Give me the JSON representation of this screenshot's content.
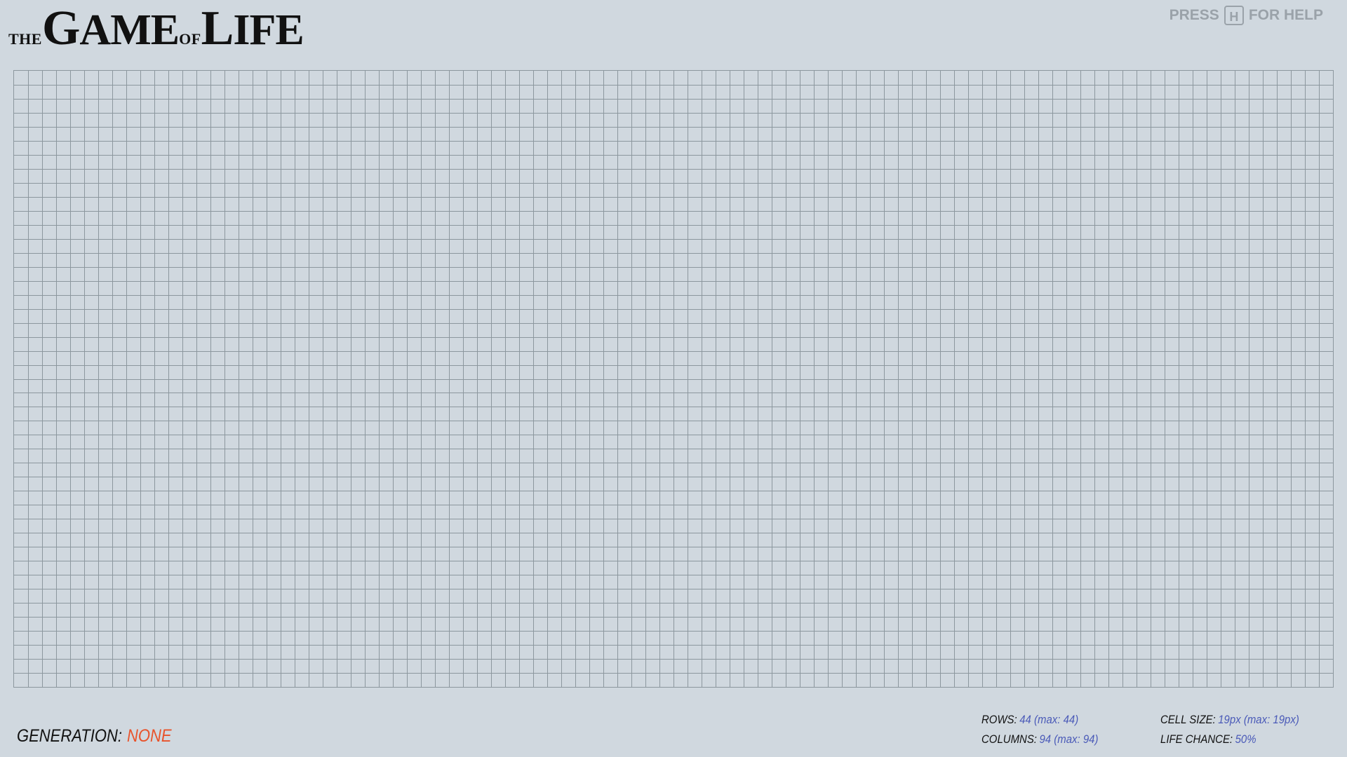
{
  "title": {
    "prefix": "THE",
    "game_first": "G",
    "game_rest": "AME",
    "of": "OF",
    "life_first": "L",
    "life_rest": "IFE"
  },
  "help": {
    "press": "PRESS",
    "key": "H",
    "for_help": "FOR HELP"
  },
  "board": {
    "rows": 44,
    "columns": 94,
    "grid_line_color": "#8c979e",
    "background_color": "#d0d8df"
  },
  "footer": {
    "generation_label": "GENERATION:",
    "generation_value": "NONE",
    "rows_label": "ROWS:",
    "rows_value": "44 (max: 44)",
    "columns_label": "COLUMNS:",
    "columns_value": "94 (max: 94)",
    "cell_size_label": "CELL SIZE:",
    "cell_size_value": "19px (max: 19px)",
    "life_chance_label": "LIFE CHANCE:",
    "life_chance_value": "50%"
  },
  "colors": {
    "accent_orange": "#e8532b",
    "value_blue": "#4a5ab8",
    "help_gray": "#9aa2a9"
  }
}
